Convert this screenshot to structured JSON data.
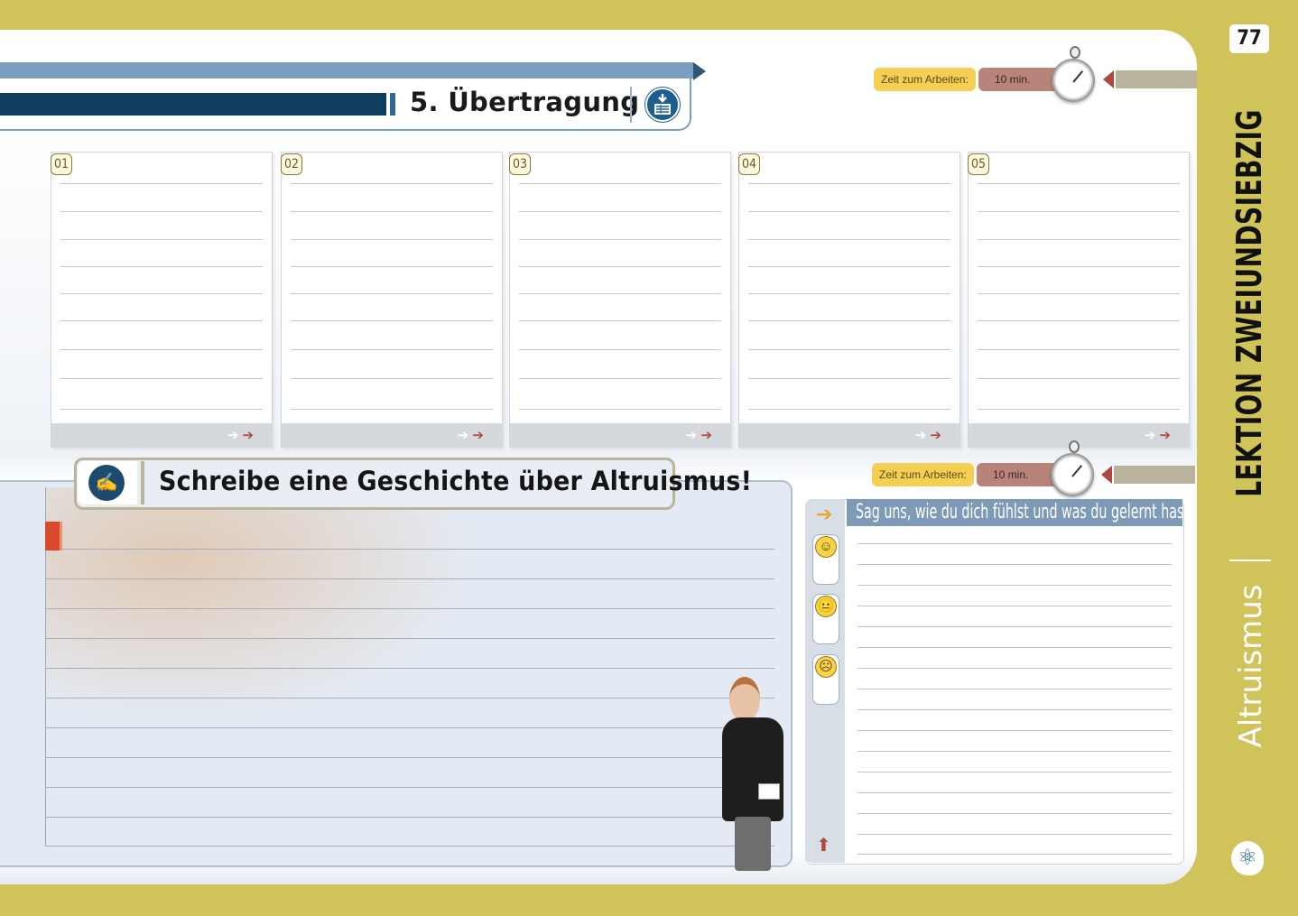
{
  "page_number": "77",
  "section": {
    "title": "5. Übertragung",
    "icon": "download-list-icon"
  },
  "timer_top": {
    "label": "Zeit zum Arbeiten:",
    "value": "10 min.",
    "icon": "stopwatch-icon"
  },
  "cards": [
    {
      "number": "01"
    },
    {
      "number": "02"
    },
    {
      "number": "03"
    },
    {
      "number": "04"
    },
    {
      "number": "05"
    }
  ],
  "task": {
    "text": "Schreibe eine Geschichte über Altruismus!",
    "icon": "writing-hand-icon"
  },
  "timer_bottom": {
    "label": "Zeit zum Arbeiten:",
    "value": "10 min.",
    "icon": "stopwatch-icon"
  },
  "feedback": {
    "header": "Sag uns, wie du dich fühlst und was du gelernt hast !",
    "emotions": [
      "smiley-happy-icon",
      "smiley-neutral-icon",
      "smiley-sad-icon"
    ]
  },
  "sidebar": {
    "lesson": "LEKTION ZWEIUNDSIEBZIG",
    "topic": "Altruismus",
    "logo": "atom-head-logo"
  },
  "colors": {
    "frame": "#cfc35a",
    "title_dark": "#0e3d5e",
    "title_light": "#7a9fbf",
    "time_label": "#f5cf53",
    "time_value": "#b8847a",
    "arrow_red": "#b24a3c"
  }
}
